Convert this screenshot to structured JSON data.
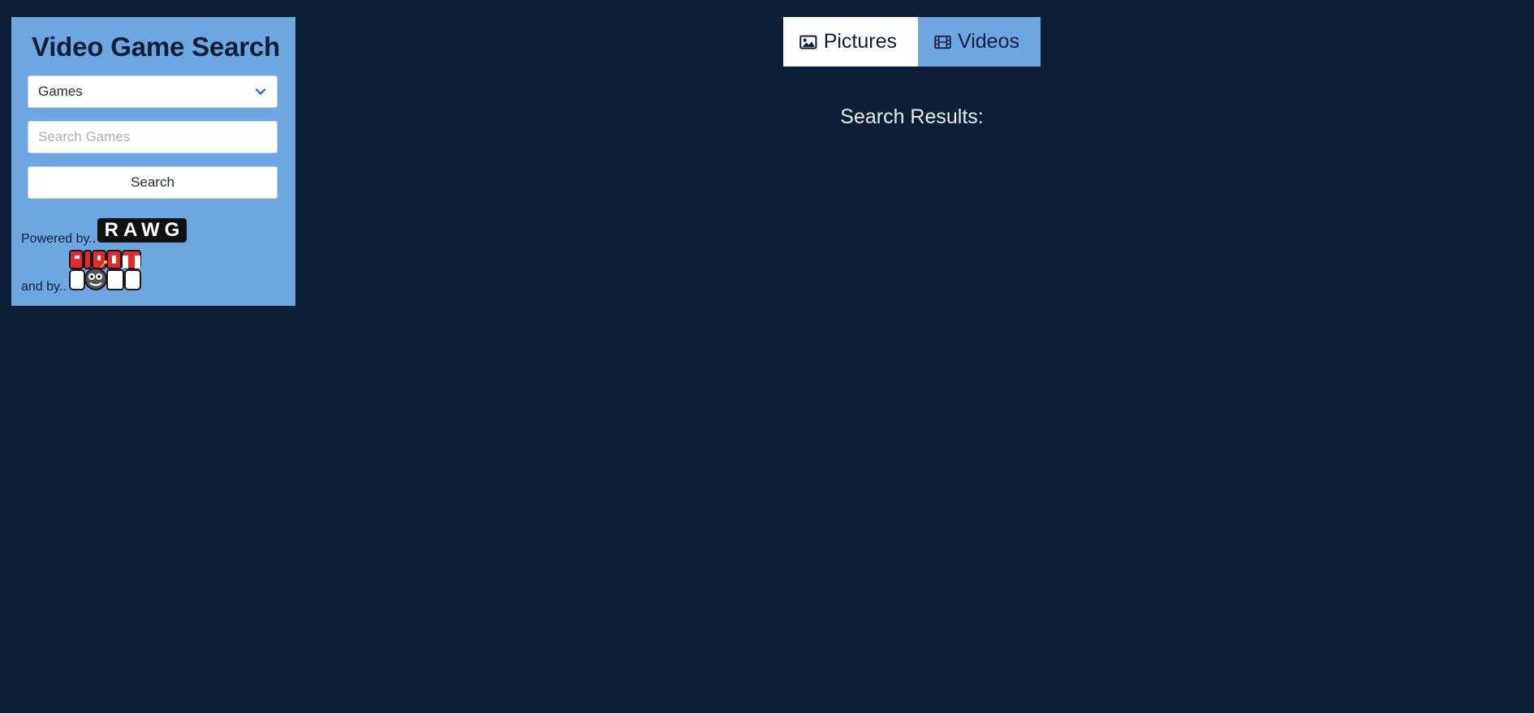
{
  "sidebar": {
    "title": "Video Game Search",
    "select": {
      "value": "Games",
      "icon": "chevron-down-icon"
    },
    "search": {
      "placeholder": "Search Games",
      "value": ""
    },
    "search_button_label": "Search",
    "powered_by_text": "Powered by..",
    "rawg_logo_text": "RAWG",
    "and_by_text": "and by..",
    "giantbomb_logo_text": "GIANT BOMB"
  },
  "tabs": [
    {
      "label": "Pictures",
      "icon": "image-icon",
      "active": true
    },
    {
      "label": "Videos",
      "icon": "film-icon",
      "active": false
    }
  ],
  "results": {
    "heading": "Search Results:"
  },
  "colors": {
    "background": "#0c1f36",
    "sidebar": "#6ea6e2",
    "active_tab": "#ffffff",
    "inactive_tab": "#6ea6e2",
    "chevron": "#2f6fd0"
  }
}
